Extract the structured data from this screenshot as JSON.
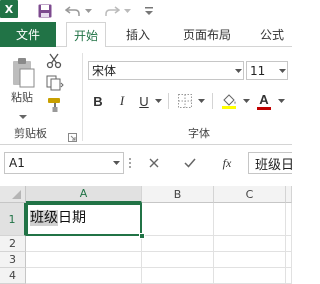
{
  "quick_access": {
    "excel_logo": "X"
  },
  "tabs": [
    "文件",
    "开始",
    "插入",
    "页面布局",
    "公式"
  ],
  "ribbon": {
    "paste_label": "粘贴",
    "clipboard_group": "剪贴板",
    "font_group": "字体",
    "font_name": "宋体",
    "font_size": "11",
    "bold": "B",
    "italic": "I",
    "underline": "U",
    "font_color": "A",
    "font_color_hex": "#c00000"
  },
  "formula_bar": {
    "name_box": "A1",
    "fx": "fx",
    "content": "班级日期"
  },
  "grid": {
    "columns": [
      "A",
      "B",
      "C"
    ],
    "rows": [
      "1",
      "2",
      "3",
      "4"
    ],
    "a1_highlighted": "班级",
    "a1_rest": "日期"
  },
  "colors": {
    "accent": "#217346"
  }
}
